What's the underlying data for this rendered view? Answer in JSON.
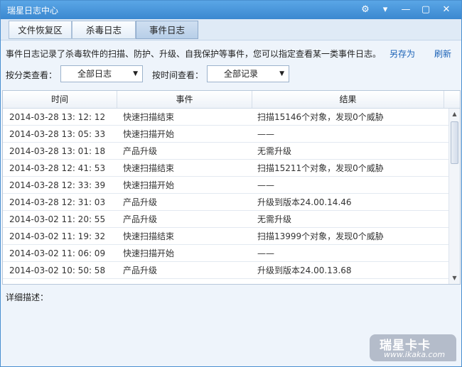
{
  "window": {
    "title": "瑞星日志中心"
  },
  "controls": {
    "settings_icon": "gear-icon",
    "menu_icon": "dropdown-menu-icon",
    "minimize_icon": "minimize-icon",
    "maximize_icon": "maximize-icon",
    "close_icon": "close-icon",
    "settings_glyph": "⚙",
    "menu_glyph": "▾",
    "minimize_glyph": "—",
    "maximize_glyph": "▢",
    "close_glyph": "✕"
  },
  "tabs": [
    {
      "label": "文件恢复区"
    },
    {
      "label": "杀毒日志"
    },
    {
      "label": "事件日志",
      "active": true
    }
  ],
  "header": {
    "description": "事件日志记录了杀毒软件的扫描、防护、升级、自我保护等事件，您可以指定查看某一类事件日志。",
    "save_as": "另存为",
    "refresh": "刷新"
  },
  "filters": {
    "category_label": "按分类查看：",
    "category_value": "全部日志",
    "time_label": "按时间查看：",
    "time_value": "全部记录",
    "arrow_glyph": "▼"
  },
  "table": {
    "columns": [
      "时间",
      "事件",
      "结果"
    ],
    "rows": [
      {
        "time": "2014-03-28 13: 12: 12",
        "event": "快速扫描结束",
        "result": "扫描15146个对象，发现0个威胁"
      },
      {
        "time": "2014-03-28 13: 05: 33",
        "event": "快速扫描开始",
        "result": "——"
      },
      {
        "time": "2014-03-28 13: 01: 18",
        "event": "产品升级",
        "result": "无需升级"
      },
      {
        "time": "2014-03-28 12: 41: 53",
        "event": "快速扫描结束",
        "result": "扫描15211个对象，发现0个威胁"
      },
      {
        "time": "2014-03-28 12: 33: 39",
        "event": "快速扫描开始",
        "result": "——"
      },
      {
        "time": "2014-03-28 12: 31: 03",
        "event": "产品升级",
        "result": "升级到版本24.00.14.46"
      },
      {
        "time": "2014-03-02 11: 20: 55",
        "event": "产品升级",
        "result": "无需升级"
      },
      {
        "time": "2014-03-02 11: 19: 32",
        "event": "快速扫描结束",
        "result": "扫描13999个对象，发现0个威胁"
      },
      {
        "time": "2014-03-02 11: 06: 09",
        "event": "快速扫描开始",
        "result": "——"
      },
      {
        "time": "2014-03-02 10: 50: 58",
        "event": "产品升级",
        "result": "升级到版本24.00.13.68"
      }
    ],
    "scroll_up_glyph": "▲",
    "scroll_down_glyph": "▼"
  },
  "detail": {
    "label": "详细描述："
  },
  "watermark": {
    "title": "瑞星卡卡",
    "url": "www.ikaka.com"
  }
}
